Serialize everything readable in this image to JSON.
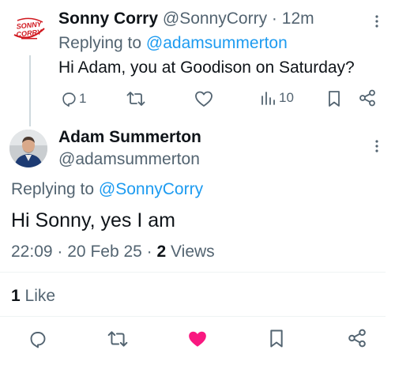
{
  "parent_tweet": {
    "author_name": "Sonny Corry",
    "author_handle": "@SonnyCorry",
    "separator": "·",
    "time_ago": "12m",
    "replying_prefix": "Replying to",
    "replying_handle": "@adamsummerton",
    "text": "Hi Adam, you at Goodison on Saturday?",
    "reply_count": "1",
    "views_count": "10",
    "avatar_logo_text": [
      "SONNY",
      "CORRY"
    ]
  },
  "main_tweet": {
    "author_name": "Adam Summerton",
    "author_handle": "@adamsummerton",
    "replying_prefix": "Replying to",
    "replying_handle": "@SonnyCorry",
    "text": "Hi Sonny, yes I am",
    "time": "22:09",
    "separator": "·",
    "date": "20 Feb 25",
    "views_count": "2",
    "views_label": "Views",
    "likes_count": "1",
    "likes_label": "Like"
  },
  "icons": {
    "reply": "reply-icon",
    "retweet": "retweet-icon",
    "like": "heart-icon",
    "views": "views-icon",
    "bookmark": "bookmark-icon",
    "share": "share-icon",
    "more": "more-vertical-icon"
  },
  "colors": {
    "text": "#0f1419",
    "secondary": "#536471",
    "accent": "#1d9bf0",
    "like_active": "#f91880",
    "logo_red": "#d0171e"
  }
}
